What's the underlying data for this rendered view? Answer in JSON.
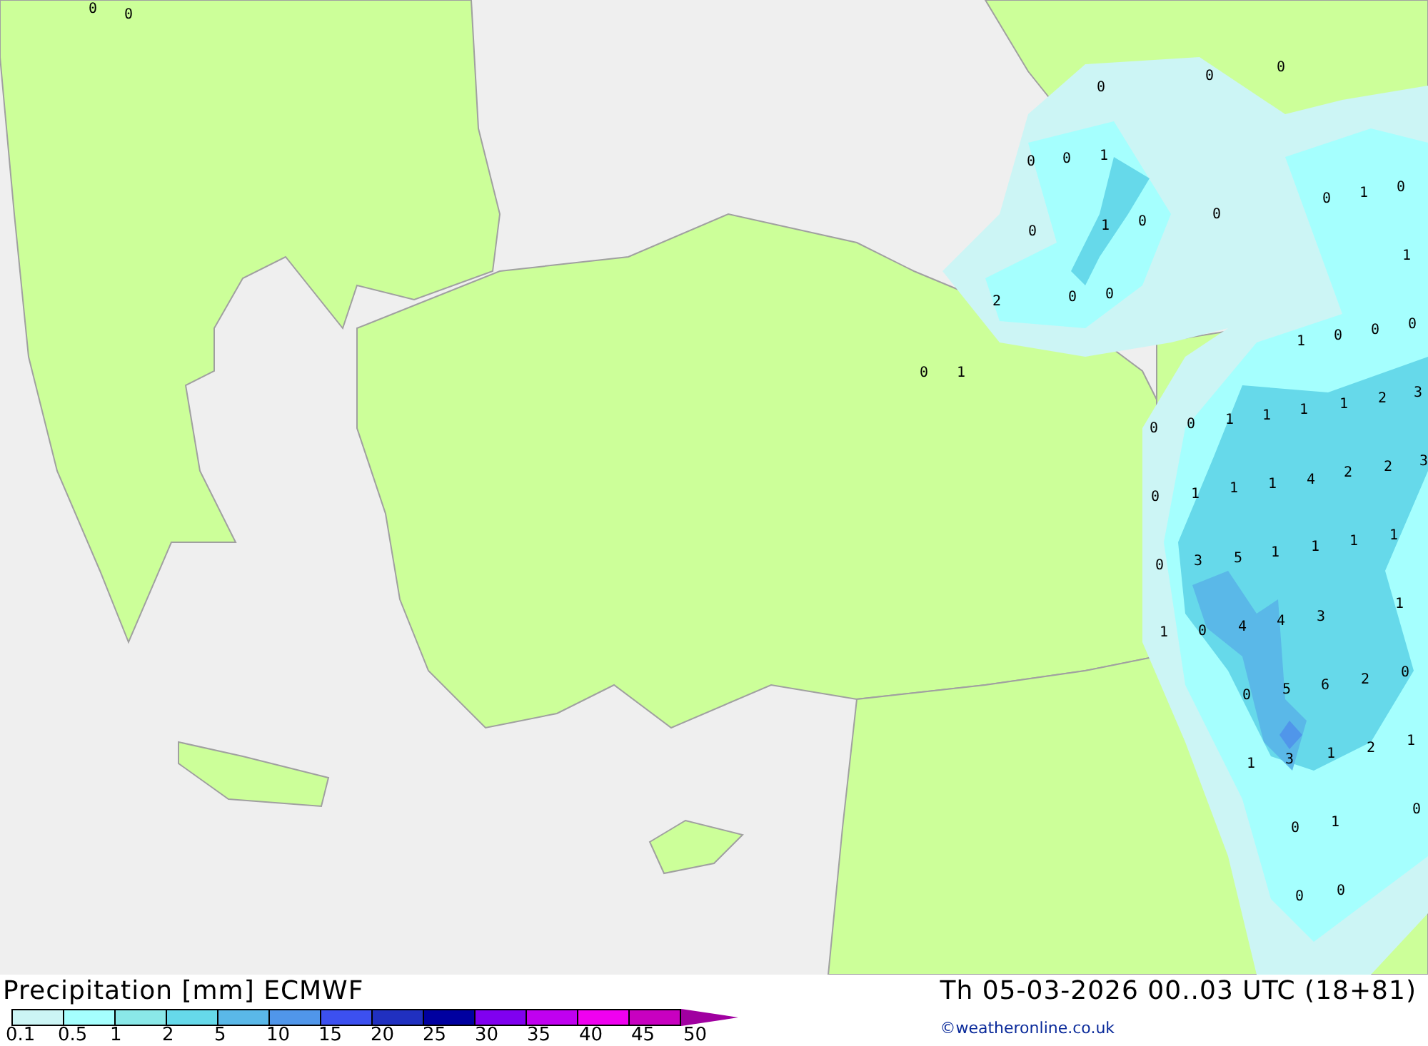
{
  "map": {
    "values": [
      "0",
      "0",
      "0",
      "0",
      "0",
      "0",
      "0",
      "1",
      "0",
      "1",
      "0",
      "0",
      "0",
      "1",
      "0",
      "1",
      "2",
      "0",
      "0",
      "0",
      "1",
      "1",
      "0",
      "0",
      "0",
      "0",
      "0",
      "1",
      "1",
      "1",
      "1",
      "2",
      "3",
      "4",
      "2",
      "2",
      "3",
      "0",
      "1",
      "1",
      "1",
      "0",
      "3",
      "5",
      "1",
      "1",
      "1",
      "1",
      "1",
      "1",
      "0",
      "4",
      "4",
      "3",
      "0",
      "5",
      "6",
      "2",
      "0",
      "1",
      "3",
      "1",
      "2",
      "1",
      "0",
      "1",
      "0",
      "0",
      "0"
    ]
  },
  "title": "Precipitation [mm] ECMWF",
  "datetime": "Th 05-03-2026 00..03 UTC (18+81)",
  "legend": {
    "bins": [
      {
        "color": "#ccf5f5"
      },
      {
        "color": "#a5fffe"
      },
      {
        "color": "#8ae8e8"
      },
      {
        "color": "#66d9ea"
      },
      {
        "color": "#5ab8e8"
      },
      {
        "color": "#5096ea"
      },
      {
        "color": "#3c50f0"
      },
      {
        "color": "#2030c0"
      },
      {
        "color": "#0000a0"
      },
      {
        "color": "#8000f0"
      },
      {
        "color": "#c000f0"
      },
      {
        "color": "#f000f0"
      },
      {
        "color": "#c800c0"
      }
    ],
    "ticks": [
      "0.1",
      "0.5",
      "1",
      "2",
      "5",
      "10",
      "15",
      "20",
      "25",
      "30",
      "35",
      "40",
      "45",
      "50"
    ]
  },
  "credit": "©weatheronline.co.uk"
}
